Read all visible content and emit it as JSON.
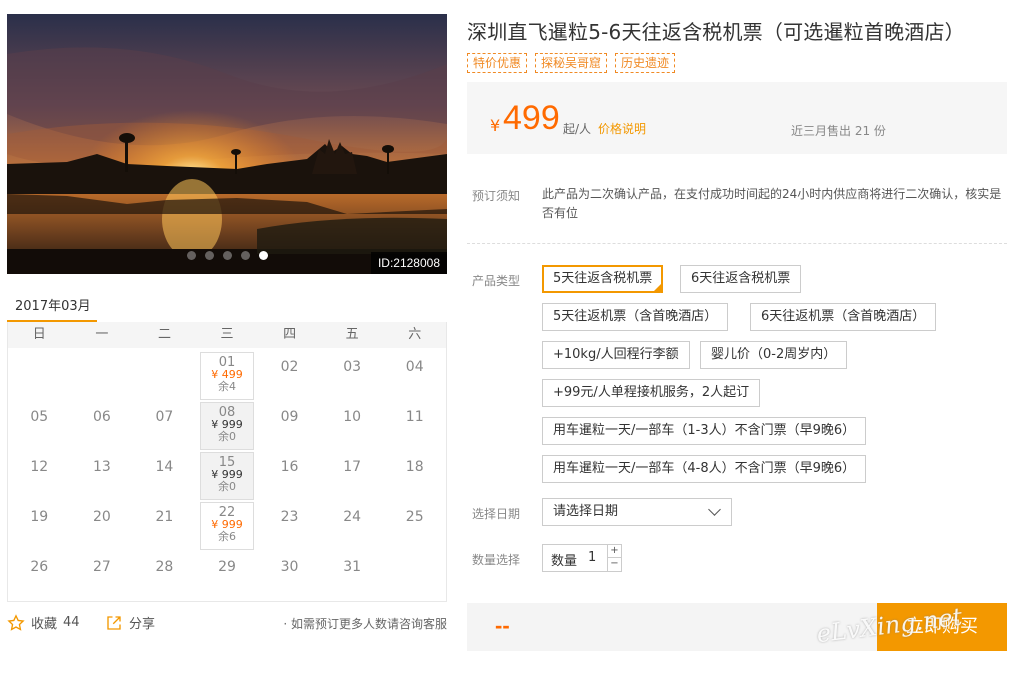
{
  "product": {
    "title": "深圳直飞暹粒5-6天往返含税机票（可选暹粒首晚酒店）",
    "id_tag": "ID:2128008",
    "tags": [
      "特价优惠",
      "探秘吴哥窟",
      "历史遗迹"
    ],
    "image_dots": 5,
    "image_active_dot": 5
  },
  "price": {
    "currency": "¥",
    "amount": "499",
    "unit": "起/人",
    "explain": "价格说明",
    "sold": "近三月售出 21 份"
  },
  "notice": {
    "label": "预订须知",
    "text": "此产品为二次确认产品，在支付成功时间起的24小时内供应商将进行二次确认，核实是否有位"
  },
  "product_types": {
    "label": "产品类型",
    "options": [
      "5天往返含税机票",
      "6天往返含税机票",
      "5天往返机票（含首晚酒店）",
      "6天往返机票（含首晚酒店）",
      "+10kg/人回程行李额",
      "婴儿价（0-2周岁内）",
      "+99元/人单程接机服务，2人起订",
      "用车暹粒一天/一部车（1-3人）不含门票（早9晚6）",
      "用车暹粒一天/一部车（4-8人）不含门票（早9晚6）"
    ],
    "selected": 0
  },
  "date": {
    "label": "选择日期",
    "placeholder": "请选择日期"
  },
  "quantity": {
    "label": "数量选择",
    "field_label": "数量",
    "value": "1",
    "plus": "+",
    "minus": "−"
  },
  "buy": {
    "total": "--",
    "button": "立即购买"
  },
  "calendar": {
    "month": "2017年03月",
    "weekdays": [
      "日",
      "一",
      "二",
      "三",
      "四",
      "五",
      "六"
    ],
    "leading_blanks": 3,
    "days": [
      {
        "d": "01",
        "price": "¥ 499",
        "remain": "余4",
        "hot": true,
        "grey": false
      },
      {
        "d": "02"
      },
      {
        "d": "03"
      },
      {
        "d": "04"
      },
      {
        "d": "05"
      },
      {
        "d": "06"
      },
      {
        "d": "07"
      },
      {
        "d": "08",
        "price": "¥ 999",
        "remain": "余0",
        "hot": false,
        "grey": true
      },
      {
        "d": "09"
      },
      {
        "d": "10"
      },
      {
        "d": "11"
      },
      {
        "d": "12"
      },
      {
        "d": "13"
      },
      {
        "d": "14"
      },
      {
        "d": "15",
        "price": "¥ 999",
        "remain": "余0",
        "hot": false,
        "grey": true
      },
      {
        "d": "16"
      },
      {
        "d": "17"
      },
      {
        "d": "18"
      },
      {
        "d": "19"
      },
      {
        "d": "20"
      },
      {
        "d": "21"
      },
      {
        "d": "22",
        "price": "¥ 999",
        "remain": "余6",
        "hot": true,
        "grey": false
      },
      {
        "d": "23"
      },
      {
        "d": "24"
      },
      {
        "d": "25"
      },
      {
        "d": "26"
      },
      {
        "d": "27"
      },
      {
        "d": "28"
      },
      {
        "d": "29"
      },
      {
        "d": "30"
      },
      {
        "d": "31"
      }
    ]
  },
  "footer_links": {
    "favorite_label": "收藏",
    "favorite_count": "44",
    "share_label": "分享",
    "tip": "· 如需预订更多人数请咨询客服"
  },
  "watermark": "eLvXing.net",
  "colors": {
    "accent": "#f39800",
    "price": "#ff6a00"
  }
}
